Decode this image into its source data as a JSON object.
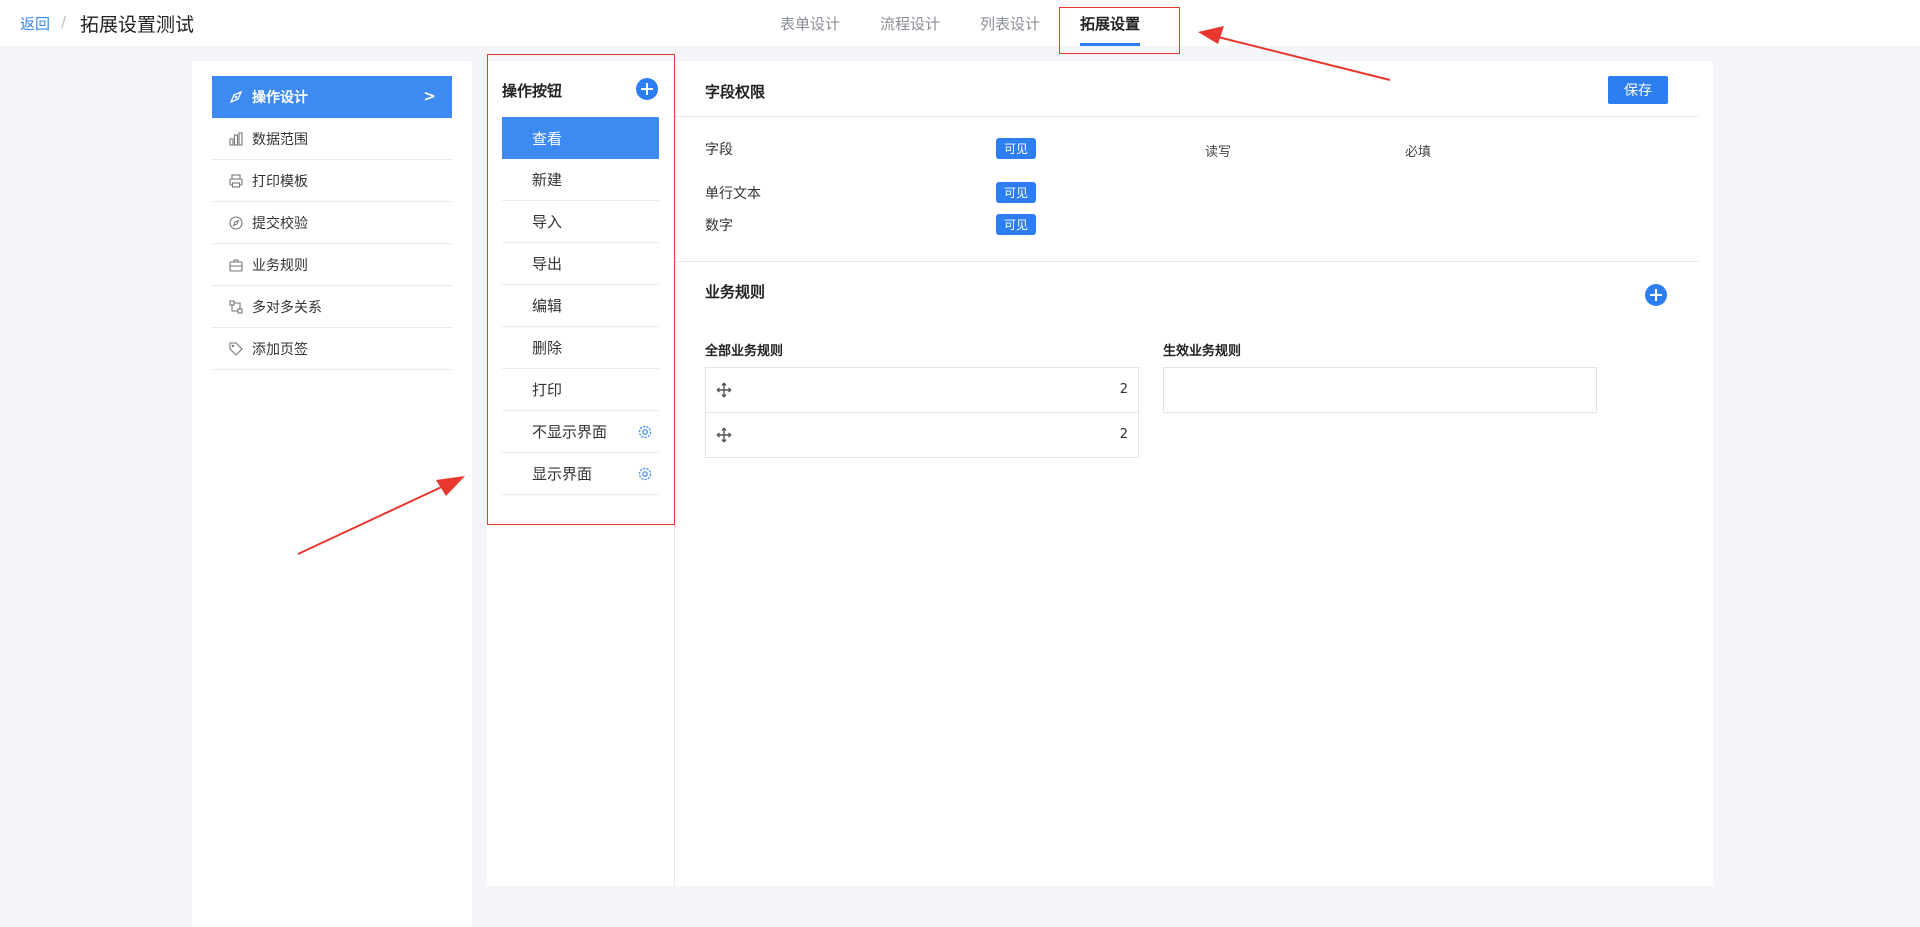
{
  "header": {
    "back_label": "返回",
    "separator": "/",
    "title": "拓展设置测试",
    "tabs": [
      {
        "label": "表单设计"
      },
      {
        "label": "流程设计"
      },
      {
        "label": "列表设计"
      },
      {
        "label": "拓展设置",
        "active": true
      }
    ]
  },
  "sidebar": {
    "items": [
      {
        "label": "操作设计",
        "icon": "design-icon",
        "active": true
      },
      {
        "label": "数据范围",
        "icon": "bar-chart-icon"
      },
      {
        "label": "打印模板",
        "icon": "printer-icon"
      },
      {
        "label": "提交校验",
        "icon": "compass-icon"
      },
      {
        "label": "业务规则",
        "icon": "briefcase-icon"
      },
      {
        "label": "多对多关系",
        "icon": "relation-icon"
      },
      {
        "label": "添加页签",
        "icon": "tag-icon"
      }
    ],
    "arrow": ">"
  },
  "operations": {
    "title": "操作按钮",
    "items": [
      {
        "label": "查看",
        "active": true
      },
      {
        "label": "新建"
      },
      {
        "label": "导入"
      },
      {
        "label": "导出"
      },
      {
        "label": "编辑"
      },
      {
        "label": "删除"
      },
      {
        "label": "打印"
      },
      {
        "label": "不显示界面",
        "has_settings": true
      },
      {
        "label": "显示界面",
        "has_settings": true
      }
    ]
  },
  "field_permissions": {
    "title": "字段权限",
    "save_label": "保存",
    "columns": {
      "field": "字段",
      "visible": "可见",
      "read_write": "读写",
      "required": "必填"
    },
    "rows": [
      {
        "name": "单行文本",
        "visible": "可见"
      },
      {
        "name": "数字",
        "visible": "可见"
      }
    ]
  },
  "business_rules": {
    "title": "业务规则",
    "all_title": "全部业务规则",
    "active_title": "生效业务规则",
    "all_rules": [
      {
        "value": "2"
      },
      {
        "value": "2"
      }
    ]
  },
  "colors": {
    "accent": "#2d7ef2",
    "active_bg": "#3d8af2",
    "annotation": "#e8372f",
    "page_bg": "#f3f5f8"
  }
}
